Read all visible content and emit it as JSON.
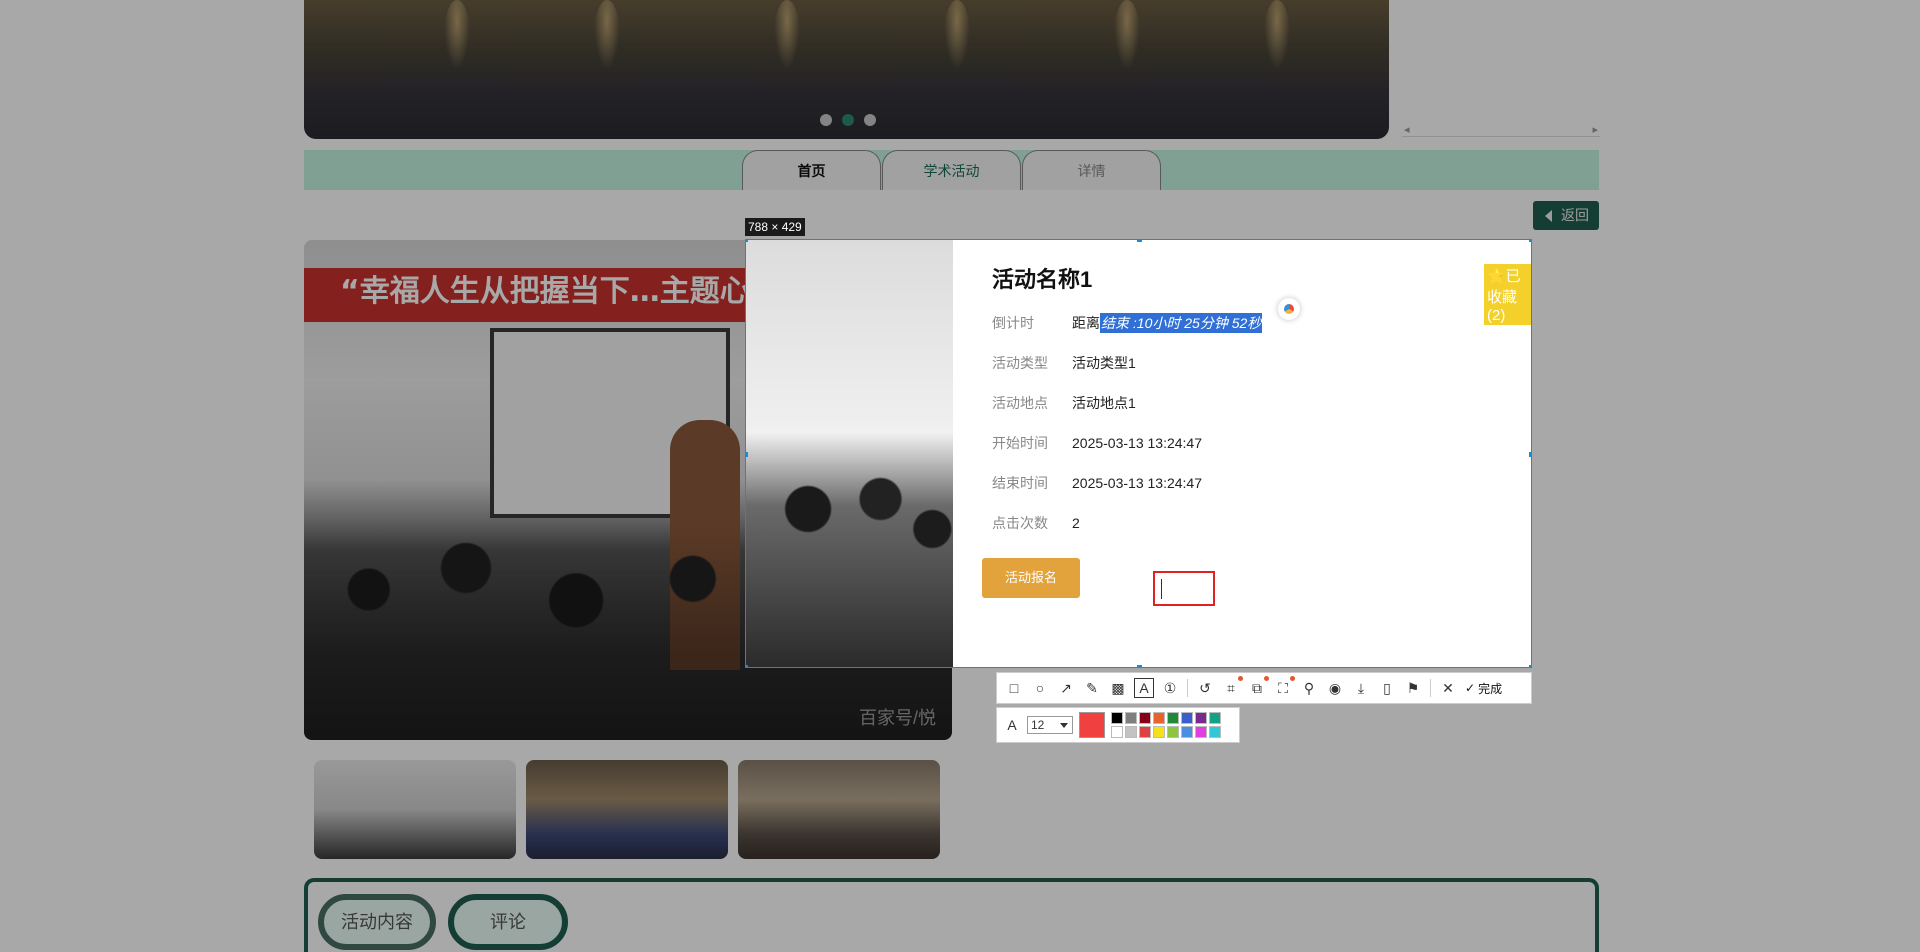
{
  "tabs": {
    "home": "首页",
    "academic": "学术活动",
    "detail": "详情"
  },
  "back_button": "返回",
  "main_photo": {
    "banner_text": "“幸福人生从把握当下…主题心理讲座",
    "watermark": "百家号/悦"
  },
  "content_tabs": {
    "content": "活动内容",
    "comment": "评论"
  },
  "screenshot_tool": {
    "size_label": "788 × 429",
    "done_label": "完成",
    "font_size": "12",
    "current_color": "#f04040",
    "palette": [
      "#000000",
      "#7f7f7f",
      "#880015",
      "#e8622a",
      "#22883a",
      "#3a5fcc",
      "#7a2a8a",
      "#16a085",
      "#ffffff",
      "#c3c3c3",
      "#e04040",
      "#f4e11a",
      "#8cc63f",
      "#4a90e2",
      "#e040e0",
      "#30c8d8"
    ],
    "tools": [
      "rectangle-icon",
      "ellipse-icon",
      "arrow-icon",
      "pen-icon",
      "mosaic-icon",
      "text-icon",
      "number-icon",
      "undo-icon",
      "scan-icon",
      "ocr-icon",
      "crop-icon",
      "pin-icon",
      "record-icon",
      "download-icon",
      "phone-icon",
      "bookmark-icon"
    ]
  },
  "activity": {
    "title": "活动名称1",
    "favorite": "⭐已收藏(2)",
    "countdown_label": "倒计时",
    "countdown_prefix": "距离",
    "countdown_selected": "结束 :10小时 25分钟 52秒",
    "type_label": "活动类型",
    "type_value": "活动类型1",
    "place_label": "活动地点",
    "place_value": "活动地点1",
    "start_label": "开始时间",
    "start_value": "2025-03-13 13:24:47",
    "end_label": "结束时间",
    "end_value": "2025-03-13 13:24:47",
    "clicks_label": "点击次数",
    "clicks_value": "2",
    "signup_button": "活动报名"
  }
}
